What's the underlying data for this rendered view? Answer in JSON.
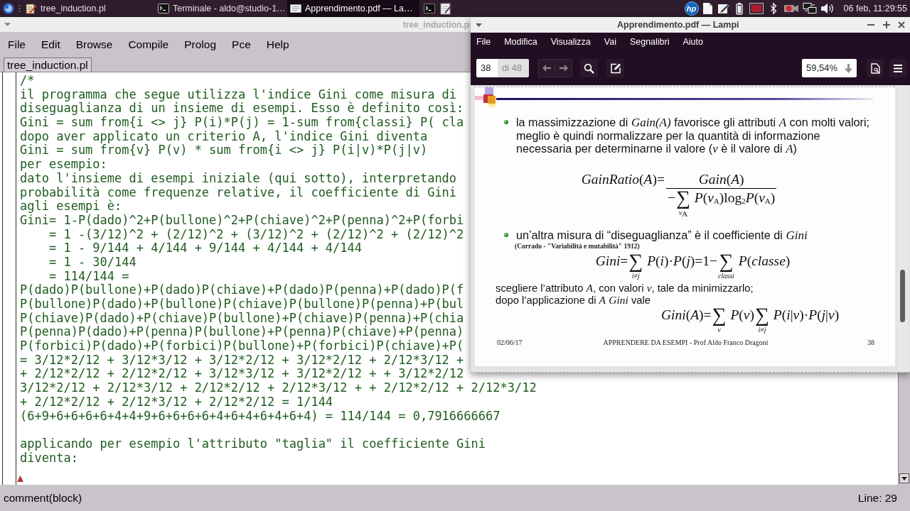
{
  "taskbar": {
    "tasks": [
      {
        "kind": "editor",
        "label": "tree_induction.pl",
        "selected": false
      },
      {
        "kind": "terminal",
        "label": "Terminale - aldo@studio-1…",
        "selected": false
      },
      {
        "kind": "document",
        "label": "Apprendimento.pdf — La…",
        "selected": true
      }
    ],
    "tray_logo": "hp",
    "clock": "06 feb, 11:29:55"
  },
  "editor_window": {
    "title": "tree_induction.p",
    "menu": [
      "File",
      "Edit",
      "Browse",
      "Compile",
      "Prolog",
      "Pce",
      "Help"
    ],
    "tabs": [
      {
        "label": "tree_induction.pl",
        "selected": true
      }
    ],
    "blocks": [
      [
        "/*",
        "il programma che segue utilizza l'indice Gini come misura di",
        "diseguaglianza di un insieme di esempi. Esso è definito così:",
        "Gini = sum from{i <> j} P(i)*P(j) = 1-sum from{classi} P( cla",
        "dopo aver applicato un criterio A, l'indice Gini diventa",
        "Gini = sum from{v} P(v) * sum from{i <> j} P(i|v)*P(j|v)",
        "per esempio:",
        "dato l'insieme di esempi iniziale (qui sotto), interpretando",
        "probabilità come frequenze relative, il coefficiente di Gini",
        "agli esempi è:",
        "Gini= 1-P(dado)^2+P(bullone)^2+P(chiave)^2+P(penna)^2+P(forbi",
        "    = 1 -(3/12)^2 + (2/12)^2 + (3/12)^2 + (2/12)^2 + (2/12)^2",
        "    = 1 - 9/144 + 4/144 + 9/144 + 4/144 + 4/144",
        "    = 1 - 30/144",
        "    = 114/144 =",
        "P(dado)P(bullone)+P(dado)P(chiave)+P(dado)P(penna)+P(dado)P(f",
        "P(bullone)P(dado)+P(bullone)P(chiave)P(bullone)P(penna)+P(bul",
        "P(chiave)P(dado)+P(chiave)P(bullone)+P(chiave)P(penna)+P(chia",
        "P(penna)P(dado)+P(penna)P(bullone)+P(penna)P(chiave)+P(penna)",
        "P(forbici)P(dado)+P(forbici)P(bullone)+P(forbici)P(chiave)+P(",
        "= 3/12*2/12 + 3/12*3/12 + 3/12*2/12 + 3/12*2/12 + 2/12*3/12 +",
        "+ 2/12*2/12 + 2/12*2/12 + 3/12*3/12 + 3/12*2/12 + + 3/12*2/12",
        "3/12*2/12 + 2/12*3/12 + 2/12*2/12 + 2/12*3/12 + + 2/12*2/12 + 2/12*3/12",
        "+ 2/12*2/12 + 2/12*3/12 + 2/12*2/12 = 1/144",
        "(6+9+6+6+6+6+4+4+9+6+6+6+6+4+6+4+6+4+6+4) = 114/144 = 0,7916666667"
      ],
      [
        "applicando per esempio l'attributo \"taglia\" il coefficiente Gini",
        "diventa:"
      ]
    ],
    "status": "comment(block)",
    "line_indicator": "Line: 29"
  },
  "pdf_window": {
    "title": "Apprendimento.pdf — Lampi",
    "menu": [
      "File",
      "Modifica",
      "Visualizza",
      "Vai",
      "Segnalibri",
      "Aiuto"
    ],
    "toolbar": {
      "page": "38",
      "page_count": "di 48",
      "zoom": "59,54%"
    },
    "slide": {
      "items": [
        {
          "kind": "bullet",
          "lines": [
            "la massimizzazione di *Gain(A)* favorisce gli attributi *A* con molti valori;",
            "meglio è quindi normalizzare per la quantità di informazione",
            "necessaria per determinarne il valore (*v* è il valore di *A*)"
          ]
        },
        {
          "kind": "formula",
          "tokens": [
            {
              "kind": "text",
              "text": "*GainRatio*(*A*)="
            },
            {
              "kind": "fraction",
              "numerator": [
                {
                  "kind": "text",
                  "text": "*Gain*(*A*)"
                }
              ],
              "denominator": [
                {
                  "kind": "text",
                  "text": "−"
                },
                {
                  "kind": "sum",
                  "symbol": "∑",
                  "under": "*v*$_{A}$"
                },
                {
                  "kind": "text",
                  "text": " *P*(*v*$_{A}$)log$_{2}$*P*(*v*$_{A}$)"
                }
              ]
            }
          ]
        },
        {
          "kind": "bullet",
          "lines": [
            "un’altra misura di “diseguaglianza” è il coefficiente di *Gini*"
          ]
        },
        {
          "kind": "citation",
          "lines": [
            "(Corrado - \"Variabilità e mutabilità\" 1912)"
          ]
        },
        {
          "kind": "formula",
          "tokens": [
            {
              "kind": "text",
              "text": "*Gini*="
            },
            {
              "kind": "sum",
              "symbol": "∑",
              "under": "*i*≠*j*"
            },
            {
              "kind": "text",
              "text": " *P*(*i*)·*P*(*j*)=1−"
            },
            {
              "kind": "sum",
              "symbol": "∑",
              "under": "*classi*"
            },
            {
              "kind": "text",
              "text": " *P*(*classe*)"
            }
          ]
        },
        {
          "kind": "paragraph",
          "lines": [
            "scegliere l’attributo *A*, con valori *v*, tale da minimizzarlo;",
            "dopo l’applicazione di *A* *Gini* vale"
          ]
        },
        {
          "kind": "formula",
          "tokens": [
            {
              "kind": "text",
              "text": "*Gini*(*A*)="
            },
            {
              "kind": "sum",
              "symbol": "∑",
              "under": "*v*"
            },
            {
              "kind": "text",
              "text": " *P*(*v*)"
            },
            {
              "kind": "sum",
              "symbol": "∑",
              "under": "*i*≠*j*"
            },
            {
              "kind": "text",
              "text": " *P*(*i*|*v*)·*P*(*j*|*v*)"
            }
          ]
        }
      ],
      "footer": {
        "date": "02/06/17",
        "title": "APPRENDERE DA ESEMPI - Prof Aldo Franco Dragoni",
        "page": "38"
      }
    }
  }
}
